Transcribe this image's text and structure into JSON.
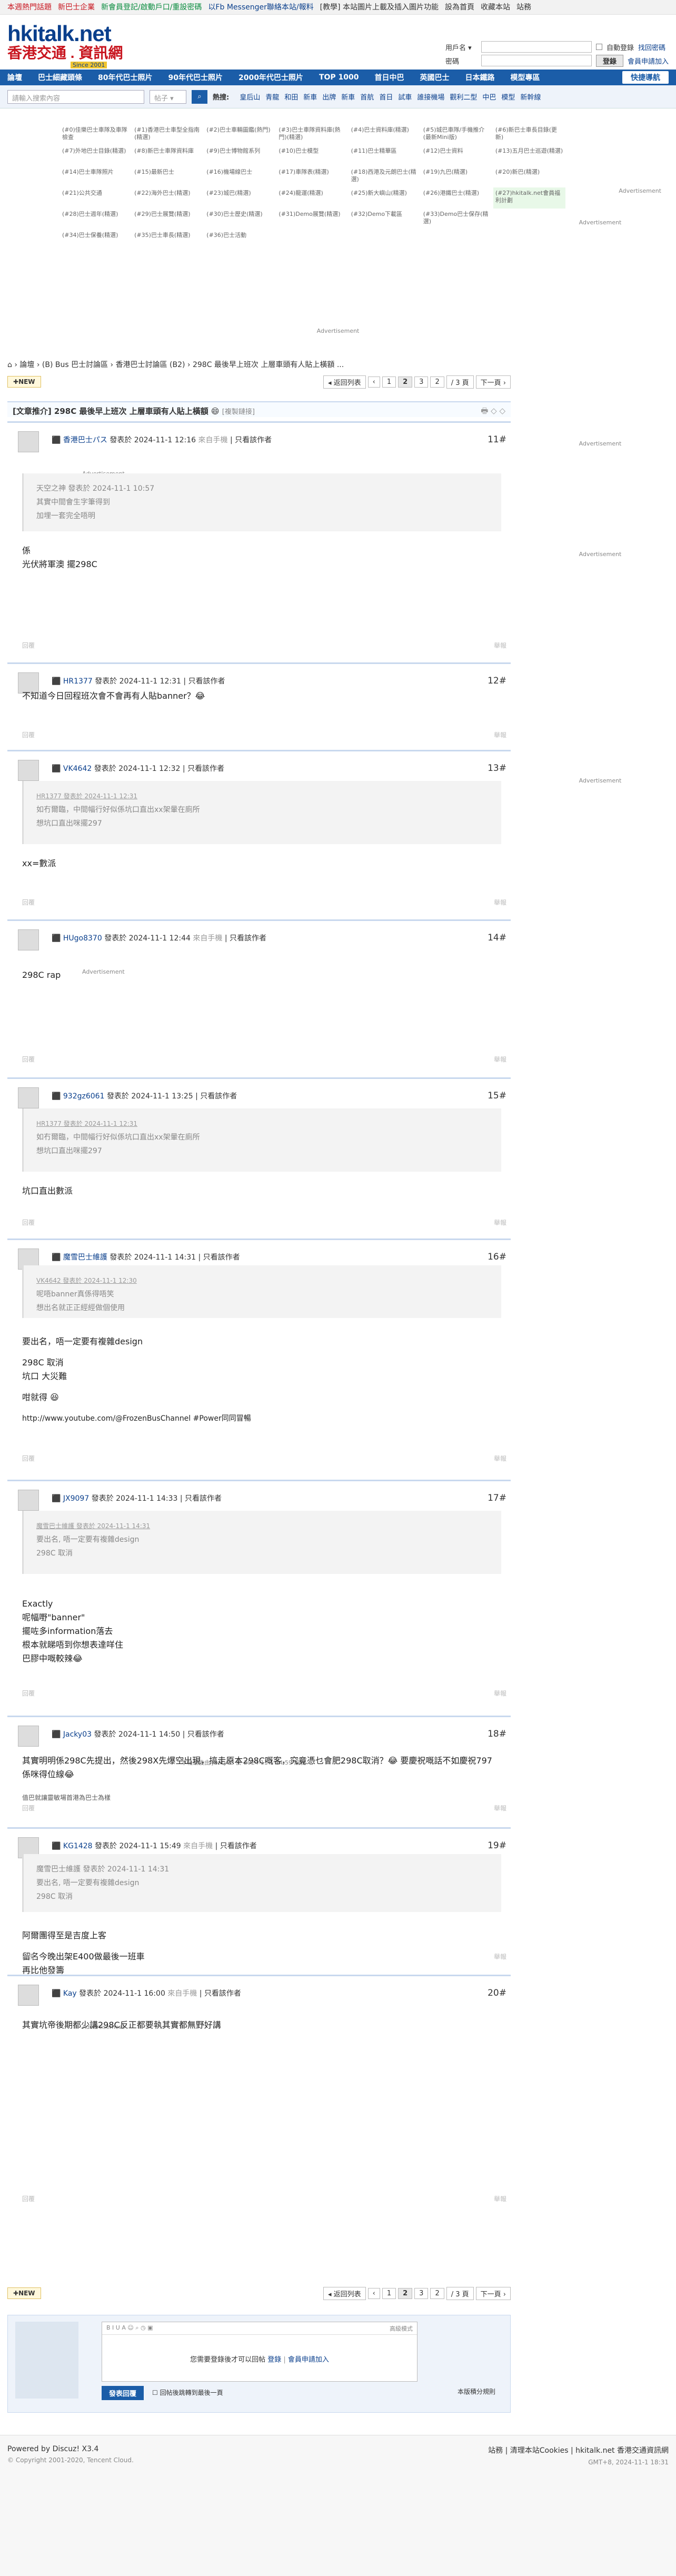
{
  "topbar": {
    "links": [
      {
        "text": "本週熱門話題",
        "color": "#c8141e"
      },
      {
        "text": "新巴士企業",
        "color": "#c8141e"
      },
      {
        "text": "新會員登記/啟動戶口/重設密碼",
        "color": "#0a8c3f"
      },
      {
        "text": "以Fb Messenger聯絡本站/報料",
        "color": "#0a3f8c"
      },
      {
        "text": "[教學] 本站圖片上載及插入圖片功能",
        "color": "#333"
      },
      {
        "text": "設為首頁",
        "color": "#333"
      },
      {
        "text": "收藏本站",
        "color": "#333"
      },
      {
        "text": "站務",
        "color": "#333"
      }
    ]
  },
  "logo": {
    "line1": "hkitalk.net",
    "line2": "香港交通 . 資訊網",
    "line3": "Since 2001"
  },
  "login": {
    "user_label": "用戶名 ▾",
    "pass_label": "密碼",
    "auto_login": "自動登錄",
    "forgot": "找回密碼",
    "login_button": "登錄",
    "register": "會員申請加入"
  },
  "nav": {
    "items": [
      "論壇",
      "巴士細藏頭條",
      "80年代巴士照片",
      "90年代巴士照片",
      "2000年代巴士照片",
      "TOP 1000",
      "首日中巴",
      "英國巴士",
      "日本鐵路",
      "模型專區"
    ],
    "quick": "快捷導航"
  },
  "search": {
    "placeholder": "請輸入搜索內容",
    "select_value": "帖子 ▾",
    "hot_label": "熱搜:",
    "hot_words": [
      "皇后山",
      "青龍",
      "和田",
      "新車",
      "出牌",
      "新車",
      "首航",
      "首日",
      "試車",
      "誰接機場",
      "觀利二型",
      "中巴",
      "模型",
      "新幹線"
    ]
  },
  "ads": {
    "cells": [
      "(#0)佳樂巴士車隊及車隊檢查",
      "(#1)香港巴士車型全指南(精選)",
      "(#2)巴士車輛圖鑑(熱門)",
      "(#3)巴士車隊資料庫(熱門)(精選)",
      "(#4)巴士資料庫(精選)",
      "(#5)城巴車隊/手機推介(最新Mini版)",
      "(#6)新巴士車長目錄(更新)",
      "(#7)外地巴士目錄(精選)",
      "(#8)新巴士車隊資料庫",
      "(#9)巴士博物館系列",
      "(#10)巴士模型",
      "(#11)巴士精華區",
      "(#12)巴士資料",
      "(#13)五月巴士巡遊(精選)",
      "(#14)巴士車隊照片",
      "(#15)最新巴士",
      "(#16)機場線巴士",
      "(#17)車隊表(精選)",
      "(#18)西港及元朗巴士(精選)",
      "(#19)九巴(精選)",
      "(#20)新巴(精選)",
      "(#21)公共交通",
      "(#22)海外巴士(精選)",
      "(#23)城巴(精選)",
      "(#24)龍運(精選)",
      "(#25)新大嶼山(精選)",
      "(#26)港鐵巴士(精選)",
      "(#27)hkitalk.net會員福利計劃",
      "(#28)巴士週年(精選)",
      "(#29)巴士展覽(精選)",
      "(#30)巴士歷史(精選)",
      "(#31)Demo展覽(精選)",
      "(#32)Demo下載區",
      "(#33)Demo巴士保存(精選)",
      "",
      "(#34)巴士保養(精選)",
      "(#35)巴士車長(精選)",
      "(#36)巴士活動",
      "",
      "",
      "",
      ""
    ],
    "right_label": "Advertisement",
    "bottom_label": "Advertisement"
  },
  "breadcrumb": "⌂ › 論壇 › (B) Bus 巴士討論區 › 香港巴士討論區 (B2) › 298C 最後早上班次 上層車頭有人貼上橫額 ...",
  "pager": {
    "new": "NEW",
    "back": "◂ 返回列表",
    "prev": "‹",
    "p1": "1",
    "p2": "2",
    "p3": "3",
    "jump": "2",
    "total": "/ 3 頁",
    "next": "下一頁 ›"
  },
  "thread": {
    "title": "[文章推介] 298C 最後早上班次 上層車頭有人貼上橫額 😄",
    "tag": "[複製鏈接]"
  },
  "posts": [
    {
      "user": "香港巴士パス",
      "time": "發表於 2024-11-1 12:16",
      "via": "來自手機",
      "only": "只看該作者",
      "floor": "11#",
      "quote_name": "",
      "quote": [
        "天空之神 發表於 2024-11-1 10:57",
        "其實中間會生字筆得到",
        "加埋一套完全唔明"
      ],
      "body": [
        "係",
        "光伏將軍澳 擺298C"
      ]
    },
    {
      "user": "HR1377",
      "time": "發表於 2024-11-1 12:31",
      "via": "",
      "only": "只看該作者",
      "floor": "12#",
      "quote_name": "",
      "quote": [],
      "body": [
        "不知道今日回程班次會不會再有人貼banner？😂"
      ]
    },
    {
      "user": "VK4642",
      "time": "發表於 2024-11-1 12:32",
      "via": "",
      "only": "只看該作者",
      "floor": "13#",
      "quote_name": "HR1377 發表於 2024-11-1 12:31",
      "quote": [
        "如冇爾臨，中間幅行好似係坑口直出xx架暈在廁所",
        "想坑口直出咪擺297"
      ],
      "body": [
        "xx=數派"
      ]
    },
    {
      "user": "HUgo8370",
      "time": "發表於 2024-11-1 12:44",
      "via": "來自手機",
      "only": "只看該作者",
      "floor": "14#",
      "quote_name": "",
      "quote": [],
      "body": [
        "298C rap"
      ]
    },
    {
      "user": "932gz6061",
      "time": "發表於 2024-11-1 13:25",
      "via": "",
      "only": "只看該作者",
      "floor": "15#",
      "quote_name": "HR1377 發表於 2024-11-1 12:31",
      "quote": [
        "如冇爾臨，中間幅行好似係坑口直出xx架暈在廁所",
        "想坑口直出咪擺297"
      ],
      "body": [
        "坑口直出數派"
      ]
    },
    {
      "user": "魔雪巴士維護",
      "time": "發表於 2024-11-1 14:31",
      "via": "",
      "only": "只看該作者",
      "floor": "16#",
      "quote_name": "VK4642 發表於 2024-11-1 12:30",
      "quote": [
        "呢唔banner真係得唔笑",
        "想出名就正正經經做個使用"
      ],
      "body": [
        "要出名，唔一定要有複雜design",
        "",
        "298C 取消",
        "坑口 大災難",
        "",
        "咁就得 😆",
        "",
        "http://www.youtube.com/@FrozenBusChannel #Power同同冒暢"
      ]
    },
    {
      "user": "JX9097",
      "time": "發表於 2024-11-1 14:33",
      "via": "",
      "only": "只看該作者",
      "floor": "17#",
      "quote_name": "魔雪巴士維護 發表於 2024-11-1 14:31",
      "quote": [
        "要出名, 唔一定要有複雜design",
        "298C 取消"
      ],
      "body": [
        "Exactly",
        "呢幅嘢\"banner\"",
        "擺咗多information落去",
        "根本就睇唔到你想表達咩住",
        "巴膠中嘅較辣😂"
      ]
    },
    {
      "user": "Jacky03",
      "time": "發表於 2024-11-1 14:50",
      "via": "",
      "only": "只看該作者",
      "floor": "18#",
      "quote_name": "",
      "quote": [],
      "body": [
        "其實明明係298C先提出，然後298X先爆空出現，搞走原本298C嘅客，究竟憑乜會肥298C取消？😂 要慶祝嘅話不如慶祝797係咪得位線😂"
      ]
    },
    {
      "user": "KG1428",
      "time": "發表於 2024-11-1 15:49",
      "via": "來自手機",
      "only": "只看該作者",
      "floor": "19#",
      "quote_name": "",
      "quote": [
        "魔雪巴士維護 發表於 2024-11-1 14:31",
        "要出名, 唔一定要有複雜design",
        "298C 取消"
      ],
      "body": [
        "阿爾團得至是吉度上客",
        "",
        "留名今晚出架E400做最後一班車",
        "再比他發籌"
      ]
    },
    {
      "user": "Kay",
      "time": "發表於 2024-11-1 16:00",
      "via": "來自手機",
      "only": "只看該作者",
      "floor": "20#",
      "quote_name": "",
      "quote": [],
      "body": [
        "其實坑帝後期都少講298C反正都要執其實都無野好講"
      ]
    }
  ],
  "post_extras": {
    "ad": "Advertisement",
    "edit_note": "本帖最後由 jacky03 於 2024-11-1 14:59 編輯",
    "sig18": "值巴就讓靈敏場首港為巴士為樣",
    "foot_left": "回覆",
    "foot_right": "舉報"
  },
  "reply": {
    "toolbar": "B  I  U  A  ☺  ⌕  ◷  ▣",
    "mode": "高級模式",
    "msg_pre": "您需要登錄後才可以回帖",
    "login": "登錄",
    "sep": "|",
    "register": "會員申請加入",
    "button": "發表回覆",
    "checkbox": "回帖後跳轉到最後一頁",
    "rules": "本版積分規則"
  },
  "footer": {
    "powered": "Powered by Discuz! X3.4",
    "copyright": "© Copyright 2001-2020, Tencent Cloud.",
    "links": "站務 | 清理本站Cookies | hkitalk.net 香港交通資訊網",
    "gmt": "GMT+8, 2024-11-1 18:31"
  }
}
